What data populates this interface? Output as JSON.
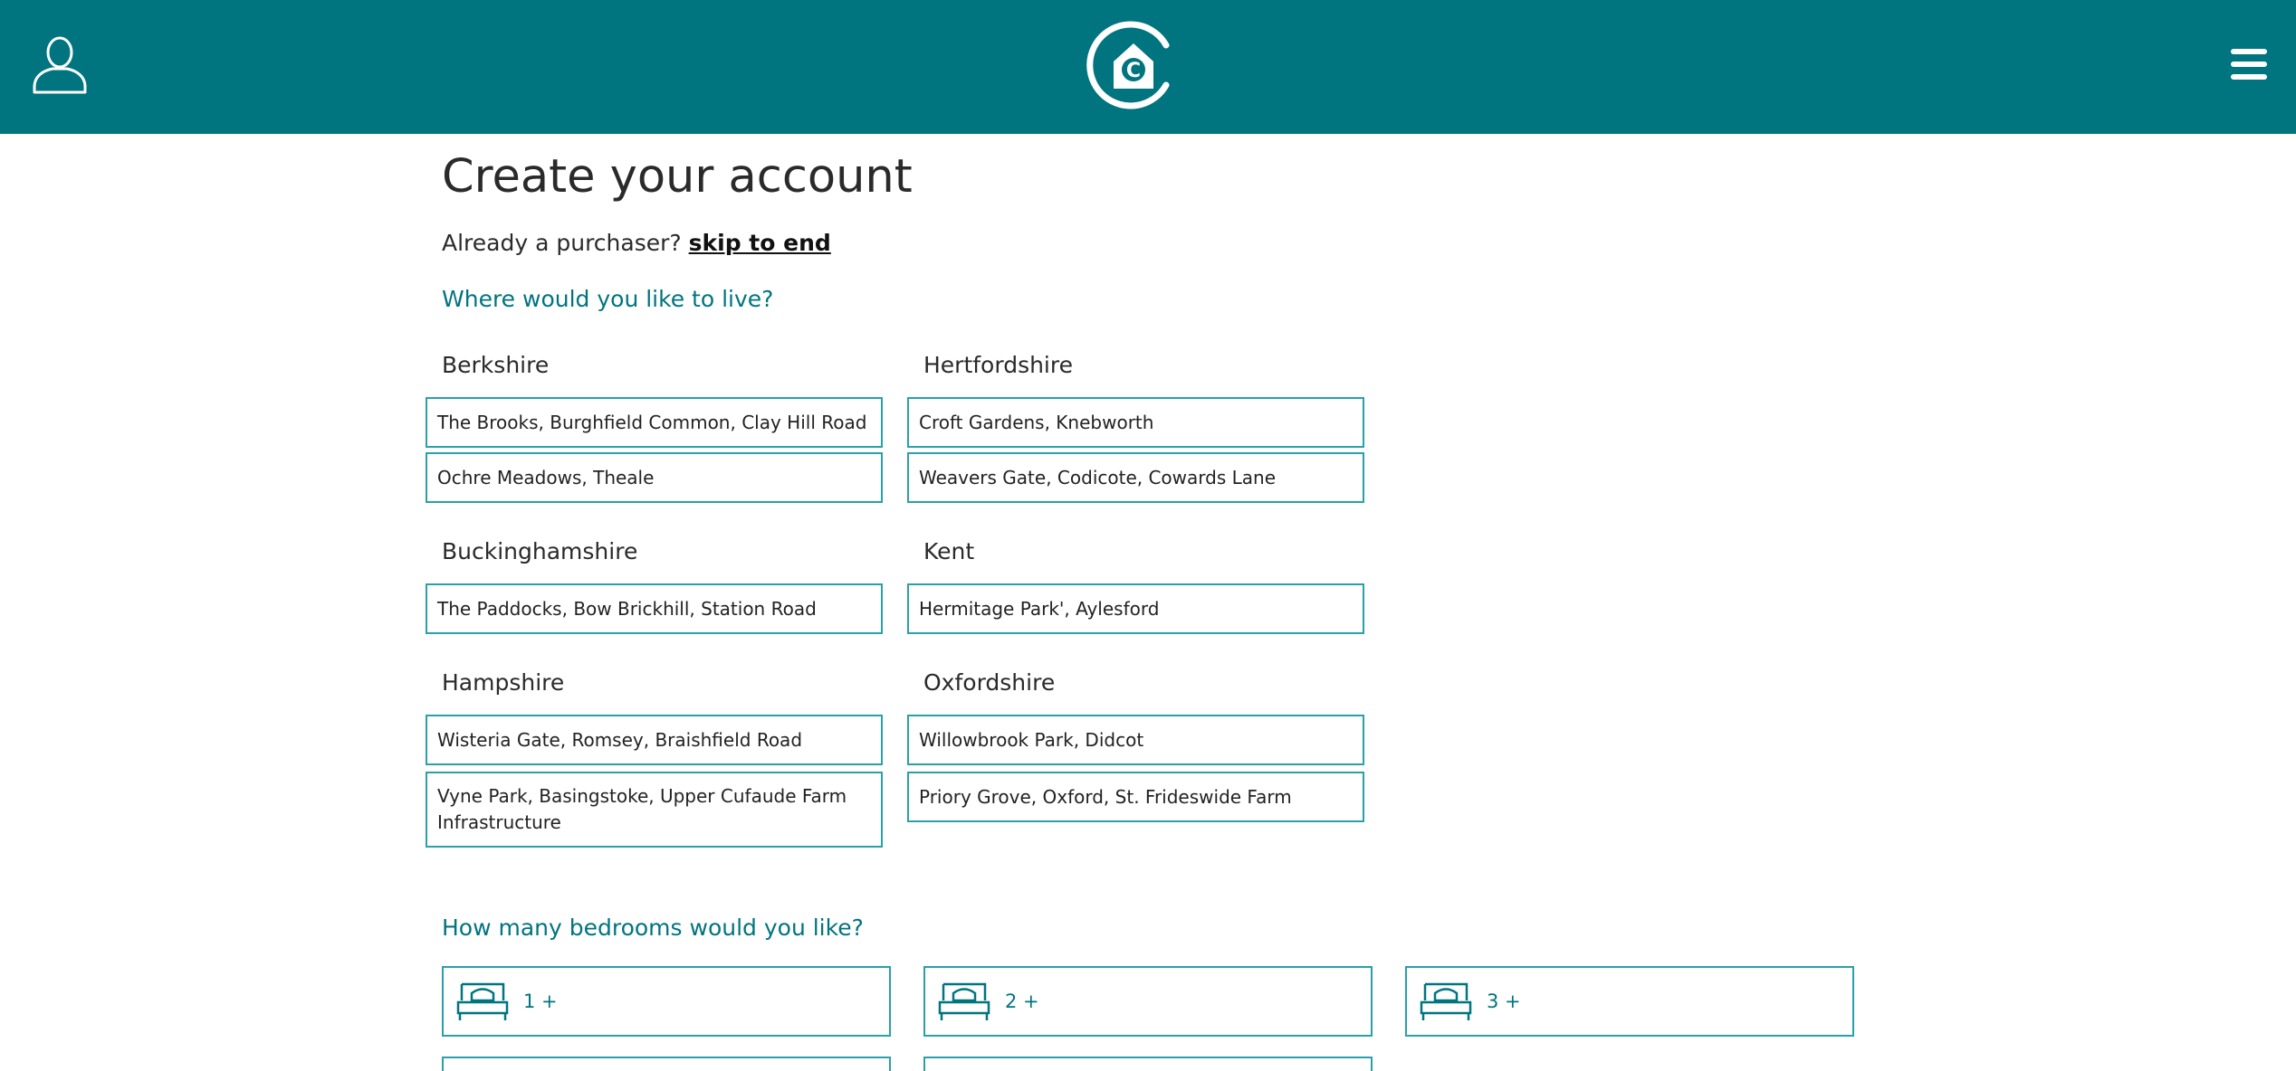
{
  "header": {
    "icons": {
      "account": "user-icon",
      "logo": "home-c-logo",
      "menu": "hamburger-menu-icon"
    },
    "accent_color": "#00747f"
  },
  "page": {
    "title": "Create your account",
    "purchaser_prompt": "Already a purchaser?",
    "skip_link": "skip to end"
  },
  "location_question": "Where would you like to live?",
  "counties": [
    {
      "name": "Berkshire",
      "developments": [
        "The Brooks, Burghfield Common, Clay Hill Road",
        "Ochre Meadows, Theale"
      ]
    },
    {
      "name": "Hertfordshire",
      "developments": [
        "Croft Gardens, Knebworth",
        "Weavers Gate, Codicote, Cowards Lane"
      ]
    },
    {
      "name": "Buckinghamshire",
      "developments": [
        "The Paddocks, Bow Brickhill, Station Road"
      ]
    },
    {
      "name": "Kent",
      "developments": [
        "Hermitage Park', Aylesford"
      ]
    },
    {
      "name": "Hampshire",
      "developments": [
        "Wisteria Gate, Romsey, Braishfield Road",
        "Vyne Park, Basingstoke, Upper Cufaude Farm Infrastructure"
      ]
    },
    {
      "name": "Oxfordshire",
      "developments": [
        "Willowbrook Park, Didcot",
        "Priory Grove, Oxford, St. Frideswide Farm"
      ]
    }
  ],
  "bedroom_question": "How many bedrooms would you like?",
  "bedroom_options": [
    {
      "label": "1 +",
      "icon": "bed-icon"
    },
    {
      "label": "2 +",
      "icon": "bed-icon"
    },
    {
      "label": "3 +",
      "icon": "bed-icon"
    }
  ]
}
